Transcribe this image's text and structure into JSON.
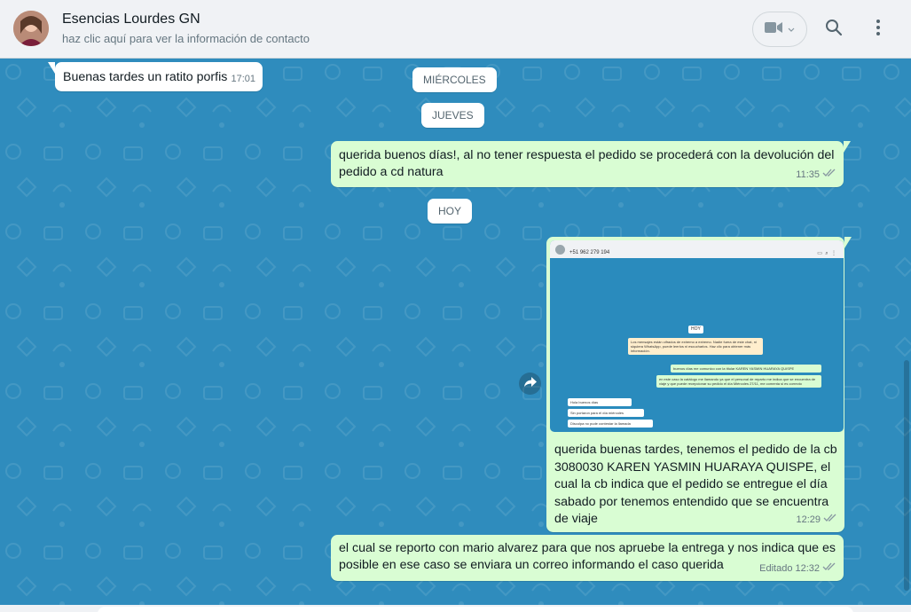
{
  "header": {
    "contact_name": "Esencias Lourdes GN",
    "contact_subtitle": "haz clic aquí para ver la información de contacto",
    "icons": [
      "video-icon",
      "chevron-down-icon",
      "search-icon",
      "menu-dots-icon"
    ]
  },
  "colors": {
    "chat_background": "#2f8cbd",
    "incoming_bubble": "#ffffff",
    "outgoing_bubble": "#d9fdd3",
    "header_background": "#f0f2f5"
  },
  "chips": {
    "wednesday": "MIÉRCOLES",
    "thursday": "JUEVES",
    "today": "HOY"
  },
  "messages": [
    {
      "direction": "in",
      "text": "Buenas tardes un ratito porfis",
      "time": "17:01"
    },
    {
      "direction": "out",
      "text": "querida buenos días!,  al no tener respuesta el pedido se procederá con la devolución del pedido a cd natura",
      "time": "11:35"
    },
    {
      "direction": "out",
      "text": "querida buenas tardes, tenemos el pedido de la cb 3080030 KAREN YASMIN HUARAYA QUISPE, el cual la cb indica que el pedido se entregue el día sabado por tenemos entendido que se encuentra de viaje",
      "time": "12:29"
    },
    {
      "direction": "out",
      "text": "el cual se reporto con mario alvarez para que nos apruebe la entrega y nos indica que es posible en ese caso se enviara un correo informando el caso querida",
      "time": "12:32",
      "edited_label": "Editado"
    }
  ],
  "thumbnail": {
    "phone": "+51 962 279 194",
    "chip": "HOY",
    "lines": [
      "Los mensajes están cifrados de extremo a extremo. Nadie fuera de este chat, ni siquiera WhatsApp, puede leerlos ni escucharlos. Haz clic para obtener más información.",
      "buenos días me comunico con la titular KAREN YASMIN HUARAYA QUISPE",
      "en este caso la catálogo me llamando ya que el personal de reparto me indica que se encuentra de viaje y que puede recepcionar su pedido el día Miércoles 27/11, me comenta si es correcto",
      "Hola buenos días",
      "Sin portaron para el día miércoles",
      "Disculpa no pude contestar la llamada"
    ]
  }
}
